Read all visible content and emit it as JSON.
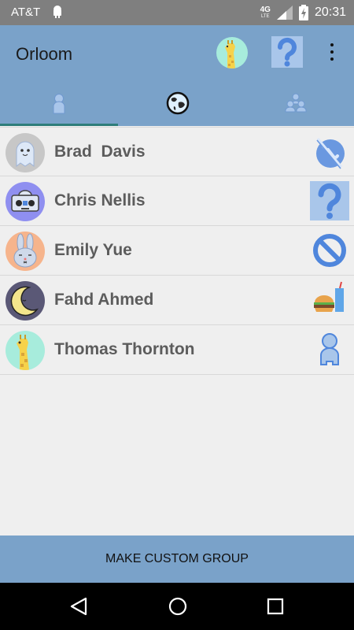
{
  "status_bar": {
    "carrier": "AT&T",
    "network": "4G",
    "network_sub": "LTE",
    "time": "20:31",
    "icons": [
      "android-icon",
      "signal-icon",
      "battery-charging-icon"
    ]
  },
  "app_bar": {
    "title": "Orloom",
    "avatar_icon": "giraffe-icon",
    "help_icon": "question-icon",
    "menu_icon": "overflow-menu-icon"
  },
  "tabs": [
    {
      "icon": "person-icon",
      "selected": true
    },
    {
      "icon": "globe-icon",
      "selected": false
    },
    {
      "icon": "group-icon",
      "selected": false
    }
  ],
  "contacts": [
    {
      "name": "Brad  Davis",
      "avatar": "ghost-icon",
      "avatar_bg": "#c7c7c7",
      "status": "muted-phone-icon"
    },
    {
      "name": "Chris Nellis",
      "avatar": "robot-icon",
      "avatar_bg": "#8f8ff0",
      "status": "question-icon"
    },
    {
      "name": "Emily Yue",
      "avatar": "bunny-icon",
      "avatar_bg": "#f6b48c",
      "status": "blocked-icon"
    },
    {
      "name": "Fahd Ahmed",
      "avatar": "moon-icon",
      "avatar_bg": "#5a5876",
      "status": "food-icon"
    },
    {
      "name": "Thomas Thornton",
      "avatar": "giraffe-icon",
      "avatar_bg": "#a7ecdc",
      "status": "person-icon"
    }
  ],
  "bottom_button": {
    "label": "MAKE CUSTOM GROUP"
  },
  "colors": {
    "primary": "#7aa2c9",
    "tab_indicator": "#2e7d7a",
    "status_icon_blue": "#4f86dc",
    "background": "#efefef"
  }
}
